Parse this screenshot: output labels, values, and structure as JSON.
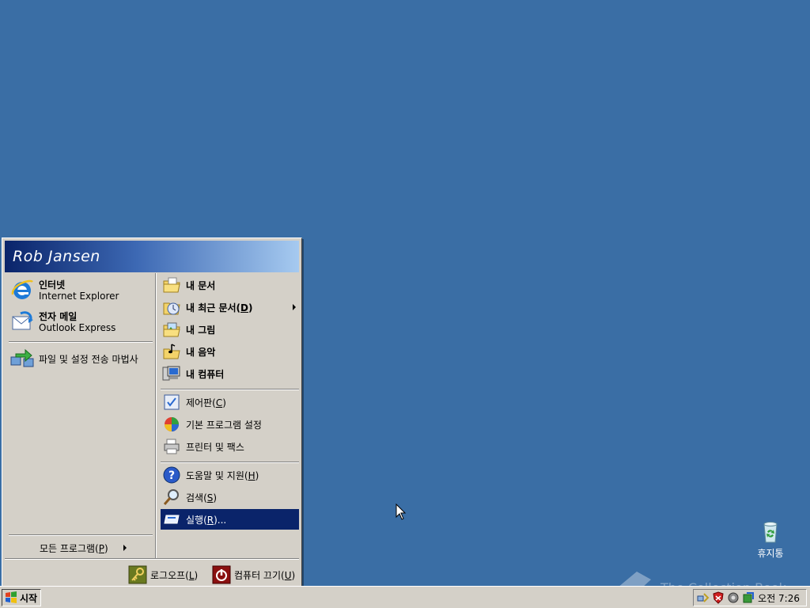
{
  "start_menu": {
    "user_name": "Rob Jansen",
    "pinned": [
      {
        "title": "인터넷",
        "subtitle": "Internet Explorer",
        "icon": "internet-explorer-icon"
      },
      {
        "title": "전자 메일",
        "subtitle": "Outlook Express",
        "icon": "outlook-express-icon"
      }
    ],
    "recent": [
      {
        "label": "파일 및 설정 전송 마법사",
        "icon": "transfer-wizard-icon"
      }
    ],
    "all_programs": {
      "text": "모든 프로그램(",
      "key": "P",
      "suffix": ")"
    },
    "right": {
      "group1": [
        {
          "label": "내 문서",
          "icon": "my-documents-icon"
        },
        {
          "text": "내 최근 문서(",
          "key": "D",
          "suffix": ")",
          "icon": "recent-documents-icon"
        },
        {
          "label": "내 그림",
          "icon": "my-pictures-icon"
        },
        {
          "label": "내 음악",
          "icon": "my-music-icon"
        },
        {
          "label": "내 컴퓨터",
          "icon": "my-computer-icon"
        }
      ],
      "group2": [
        {
          "text": "제어판(",
          "key": "C",
          "suffix": ")",
          "icon": "control-panel-icon"
        },
        {
          "label": "기본 프로그램 설정",
          "icon": "default-programs-icon"
        },
        {
          "label": "프린터 및 팩스",
          "icon": "printer-icon"
        }
      ],
      "group3": [
        {
          "text": "도움말 및 지원(",
          "key": "H",
          "suffix": ")",
          "icon": "help-icon"
        },
        {
          "text": "검색(",
          "key": "S",
          "suffix": ")",
          "icon": "search-icon"
        },
        {
          "text": "실행(",
          "key": "R",
          "suffix": ")...",
          "icon": "run-icon",
          "selected": true
        }
      ]
    },
    "footer": {
      "logoff": {
        "text": "로그오프(",
        "key": "L",
        "suffix": ")"
      },
      "shutdown": {
        "text": "컴퓨터 끄기(",
        "key": "U",
        "suffix": ")"
      }
    }
  },
  "taskbar": {
    "start_label": "시작",
    "tray_icons": [
      "network-icon",
      "security-shield-icon",
      "volume-icon",
      "update-icon"
    ],
    "clock": "오전 7:26"
  },
  "desktop": {
    "recycle_bin_label": "휴지통",
    "watermark": "The Collection Book"
  },
  "colors": {
    "desktop": "#3a6ea5",
    "menu_face": "#d4d0c8",
    "selection": "#0a246a"
  }
}
